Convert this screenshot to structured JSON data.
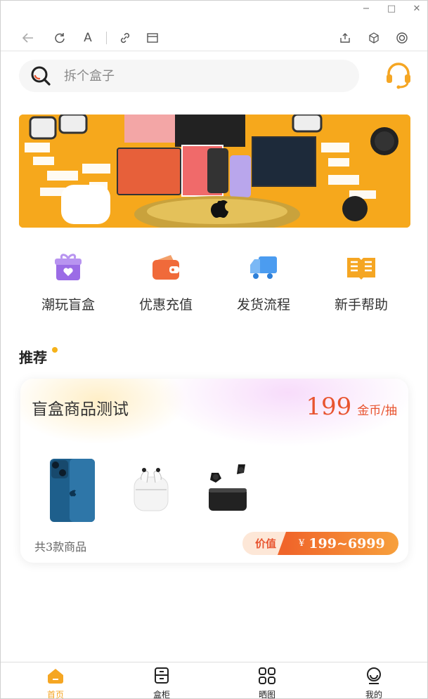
{
  "window": {
    "controls": [
      {
        "name": "minimize",
        "glyph": "−"
      },
      {
        "name": "maximize",
        "glyph": "□"
      },
      {
        "name": "close",
        "glyph": "✕"
      }
    ]
  },
  "toolbar": {
    "icons": [
      "back-icon",
      "reload-icon",
      "font-size-icon",
      "link-icon",
      "window-icon",
      "share-icon",
      "cube-icon",
      "target-icon"
    ],
    "font_glyph": "A"
  },
  "search": {
    "placeholder": "拆个盒子",
    "icon": "search-icon",
    "support_icon": "headset-icon"
  },
  "banner": {
    "icon": "apple-logo"
  },
  "categories": [
    {
      "label": "潮玩盲盒",
      "icon": "gift-box-icon",
      "color": "#9b6ce6"
    },
    {
      "label": "优惠充值",
      "icon": "wallet-icon",
      "color": "#f06a3a"
    },
    {
      "label": "发货流程",
      "icon": "truck-icon",
      "color": "#4b9cf0"
    },
    {
      "label": "新手帮助",
      "icon": "book-icon",
      "color": "#f5a623"
    }
  ],
  "recommend": {
    "title": "推荐"
  },
  "card": {
    "name": "盲盒商品测试",
    "price": "199",
    "price_unit": "金币/抽",
    "count_text": "共3款商品",
    "value_label": "价值",
    "currency": "¥",
    "value_range": "199~6999",
    "products": [
      "phone-image",
      "earbuds-case-image",
      "wireless-earbuds-image"
    ]
  },
  "tabbar": {
    "items": [
      {
        "label": "首页",
        "icon": "home-icon",
        "active": true
      },
      {
        "label": "盒柜",
        "icon": "cabinet-icon",
        "active": false
      },
      {
        "label": "晒图",
        "icon": "grid-icon",
        "active": false
      },
      {
        "label": "我的",
        "icon": "profile-icon",
        "active": false
      }
    ]
  },
  "colors": {
    "accent": "#f5a623",
    "price": "#e8542f",
    "banner_bg": "#f6a81c"
  }
}
